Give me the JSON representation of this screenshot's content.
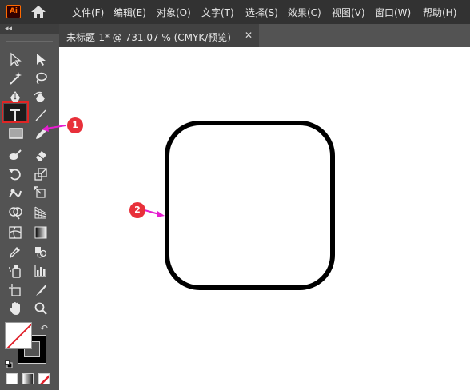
{
  "app": {
    "logo_text": "Ai",
    "menu": [
      "文件(F)",
      "编辑(E)",
      "对象(O)",
      "文字(T)",
      "选择(S)",
      "效果(C)",
      "视图(V)",
      "窗口(W)",
      "帮助(H)"
    ]
  },
  "document_tab": {
    "title": "未标题-1* @ 731.07 % (CMYK/预览)",
    "close_glyph": "✕"
  },
  "toolbar": {
    "collapse_glyph": "◂◂",
    "tools": [
      "selection-tool",
      "direct-selection-tool",
      "magic-wand-tool",
      "lasso-tool",
      "pen-tool",
      "curvature-tool",
      "type-tool",
      "line-segment-tool",
      "rectangle-tool",
      "paintbrush-tool",
      "shaper-tool",
      "eraser-tool",
      "rotate-tool",
      "scale-tool",
      "warp-tool",
      "free-transform-tool",
      "shape-builder-tool",
      "perspective-grid-tool",
      "mesh-tool",
      "gradient-tool",
      "eyedropper-tool",
      "blend-tool",
      "symbol-sprayer-tool",
      "column-graph-tool",
      "artboard-tool",
      "slice-tool",
      "hand-tool",
      "zoom-tool"
    ],
    "active_tool": "rectangle-tool",
    "fill": "none",
    "stroke": "#000000",
    "swap_glyph": "↶"
  },
  "annotations": {
    "step1": "1",
    "step2": "2",
    "color": "#e8303a",
    "arrow_color": "#e51ecf"
  },
  "canvas": {
    "shape": "rounded-rectangle",
    "stroke_color": "#000000",
    "fill": "none"
  }
}
